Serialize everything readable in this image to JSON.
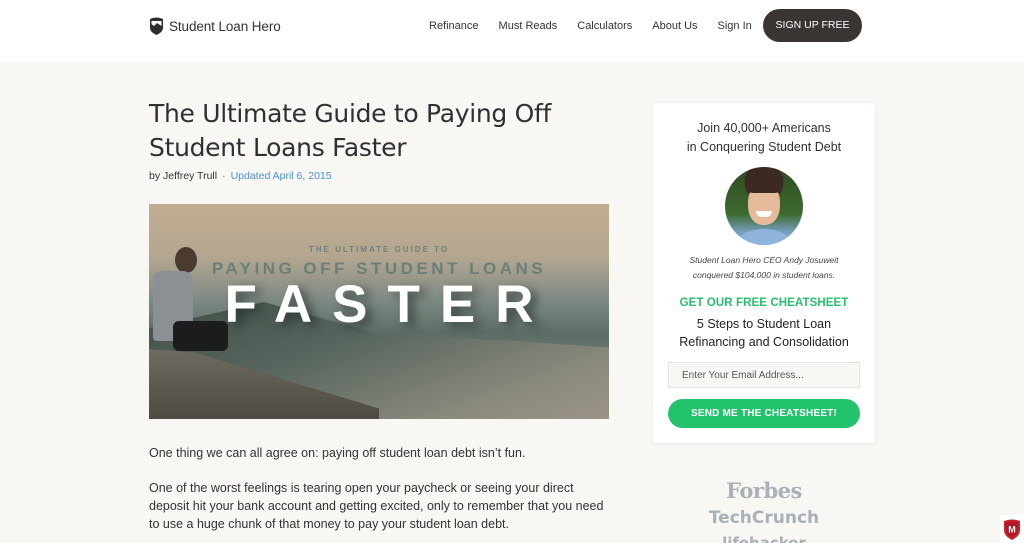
{
  "header": {
    "logo_text": "Student Loan Hero",
    "nav": [
      "Refinance",
      "Must Reads",
      "Calculators",
      "About Us",
      "Sign In"
    ],
    "signup_label": "SIGN UP FREE"
  },
  "article": {
    "title": "The Ultimate Guide to Paying Off Student Loans Faster",
    "author": "by Jeffrey Trull",
    "separator": "·",
    "updated": "Updated April 6, 2015",
    "hero": {
      "line1": "THE ULTIMATE GUIDE TO",
      "line2": "PAYING OFF STUDENT LOANS",
      "line3": "FASTER"
    },
    "paragraphs": [
      "One thing we can all agree on: paying off student loan debt isn’t fun.",
      "One of the worst feelings is tearing open your paycheck or seeing your direct deposit hit your bank account and getting excited, only to remember that you need to use a huge chunk of that money to pay your student loan debt."
    ]
  },
  "sidebar": {
    "join_line1": "Join 40,000+ Americans",
    "join_line2": "in Conquering Student Debt",
    "caption_line1": "Student Loan Hero CEO Andy Josuweit",
    "caption_line2": "conquered $104,000 in student loans.",
    "cta": "GET OUR FREE CHEATSHEET",
    "steps_line1": "5 Steps to Student Loan",
    "steps_line2": "Refinancing and Consolidation",
    "email_placeholder": "Enter Your Email Address...",
    "email_value": "",
    "send_label": "SEND ME THE CHEATSHEET!",
    "accent_color": "#23c36e"
  },
  "press": [
    "Forbes",
    "TechCrunch",
    "lifehacker"
  ],
  "badge": {
    "icon": "mcafee-shield-icon",
    "letter": "M"
  }
}
